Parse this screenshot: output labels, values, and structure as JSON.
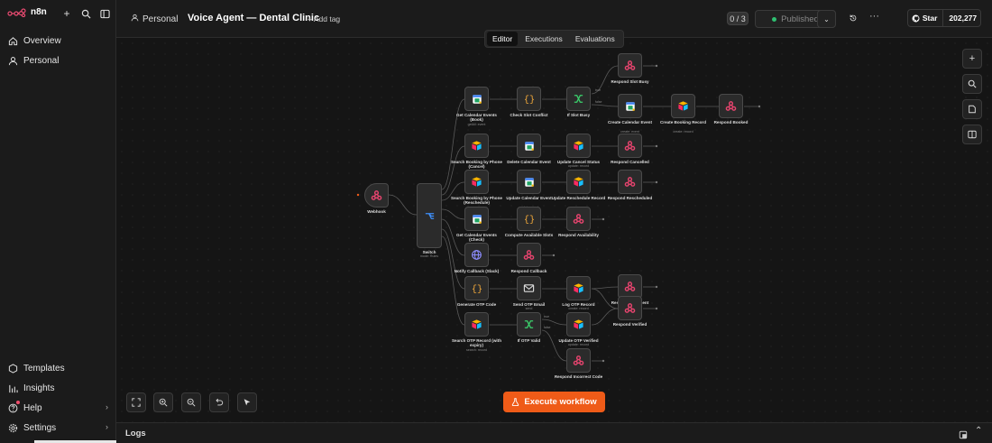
{
  "sidebar": {
    "logo": "n8n",
    "items": [
      {
        "label": "Overview",
        "icon": "home-icon"
      },
      {
        "label": "Personal",
        "icon": "user-icon"
      }
    ],
    "bottom": [
      {
        "label": "Templates",
        "icon": "templates-icon"
      },
      {
        "label": "Insights",
        "icon": "insights-icon"
      },
      {
        "label": "Help",
        "icon": "help-icon"
      },
      {
        "label": "Settings",
        "icon": "gear-icon"
      }
    ]
  },
  "header": {
    "project": "Personal",
    "workflow_name": "Voice Agent — Dental Clinic",
    "add_tag": "+ Add tag",
    "counter": "0 / 3",
    "published": "Published",
    "star_label": "Star",
    "star_count": "202,277"
  },
  "tabs": [
    "Editor",
    "Executions",
    "Evaluations"
  ],
  "execute_label": "Execute workflow",
  "logs_label": "Logs",
  "colors": {
    "accent": "#ef5b18",
    "sheets": "#1fa463",
    "switch": "#3e8ef7",
    "webhook": "#e8446f",
    "if": "#3bcf6b"
  },
  "nodes": {
    "webhook": {
      "label": "Webhook"
    },
    "switch": {
      "label": "Switch",
      "sub": "mode: Rules"
    },
    "get_cal_book": {
      "label": "Get Calendar Events (Book)",
      "sub": "getAll: event"
    },
    "check_slot": {
      "label": "Check Slot Conflict"
    },
    "if_slot": {
      "label": "If Slot Busy"
    },
    "respond_busy": {
      "label": "Respond Slot Busy"
    },
    "create_cal": {
      "label": "Create Calendar Event",
      "sub": "create: event"
    },
    "create_booking": {
      "label": "Create Booking Record",
      "sub": "create: record"
    },
    "respond_booked": {
      "label": "Respond Booked"
    },
    "search_cancel": {
      "label": "Search Booking by Phone (Cancel)"
    },
    "delete_cal": {
      "label": "Delete Calendar Event",
      "sub": "delete: event"
    },
    "update_cancel": {
      "label": "Update Cancel Status",
      "sub": "update: record"
    },
    "respond_cancelled": {
      "label": "Respond Cancelled"
    },
    "search_resched": {
      "label": "Search Booking by Phone (Reschedule)"
    },
    "update_cal": {
      "label": "Update Calendar Event",
      "sub": "update: event"
    },
    "update_resched": {
      "label": "Update Reschedule Record"
    },
    "respond_resched": {
      "label": "Respond Rescheduled"
    },
    "get_cal_check": {
      "label": "Get Calendar Events (Check)"
    },
    "compute_slots": {
      "label": "Compute Available Slots"
    },
    "respond_avail": {
      "label": "Respond Availability"
    },
    "notify_callback": {
      "label": "Notify Callback (Slack)"
    },
    "respond_callback": {
      "label": "Respond Callback"
    },
    "generate_otp": {
      "label": "Generate OTP Code"
    },
    "send_otp": {
      "label": "Send OTP Email",
      "sub": "send"
    },
    "log_otp": {
      "label": "Log OTP Record",
      "sub": "create: record"
    },
    "respond_otp": {
      "label": "Respond OTP Sent"
    },
    "search_otp": {
      "label": "Search OTP Record (with expiry)",
      "sub": "search: record"
    },
    "if_otp": {
      "label": "If OTP Valid"
    },
    "update_otp": {
      "label": "Update OTP Verified",
      "sub": "update: record"
    },
    "respond_verified": {
      "label": "Respond Verified"
    },
    "respond_incorrect": {
      "label": "Respond Incorrect Code"
    }
  },
  "edge_labels": {
    "true": "true",
    "false": "false"
  }
}
